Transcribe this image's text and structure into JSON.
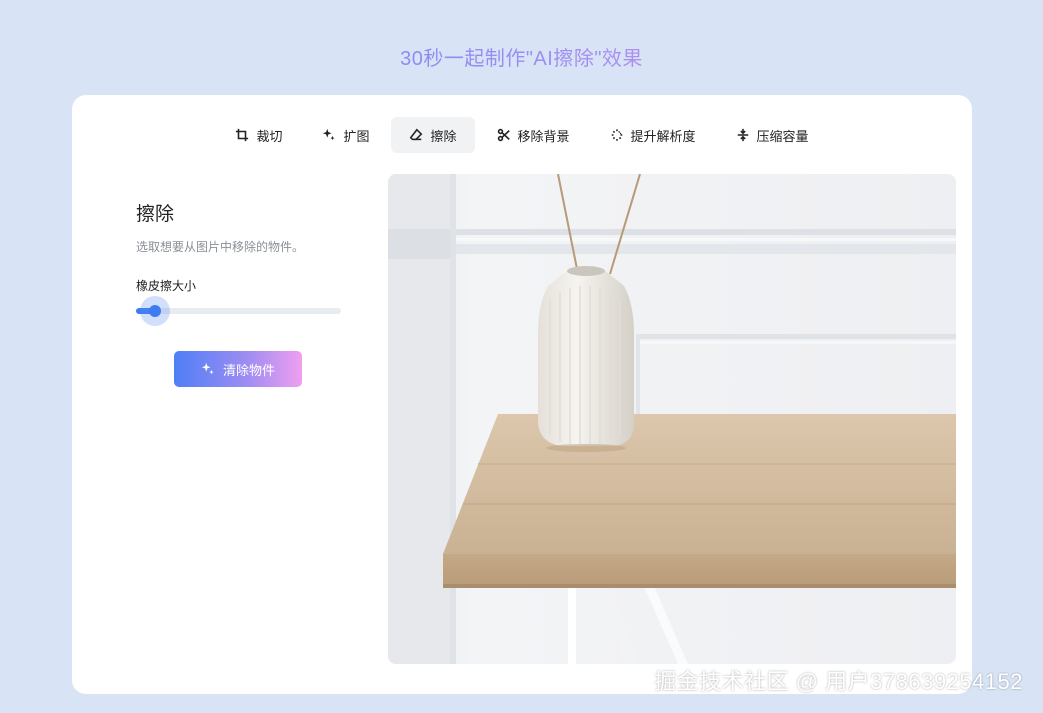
{
  "header": {
    "title": "30秒一起制作\"AI擦除\"效果"
  },
  "tabs": [
    {
      "label": "裁切",
      "icon": "crop-icon"
    },
    {
      "label": "扩图",
      "icon": "sparkle-icon"
    },
    {
      "label": "擦除",
      "icon": "eraser-icon",
      "active": true
    },
    {
      "label": "移除背景",
      "icon": "scissors-icon"
    },
    {
      "label": "提升解析度",
      "icon": "enhance-icon"
    },
    {
      "label": "压缩容量",
      "icon": "compress-icon"
    }
  ],
  "panel": {
    "title": "擦除",
    "description": "选取想要从图片中移除的物件。",
    "slider_label": "橡皮擦大小",
    "slider_value_fraction": 0.1,
    "button_label": "清除物件",
    "button_icon": "sparkle-icon"
  },
  "preview": {
    "image_icon": "preview-image"
  },
  "watermark": {
    "text": "掘金技术社区 @ 用户378639254152"
  },
  "colors": {
    "page_bg": "#d8e4f5",
    "accent": "#3d7bf0",
    "gradient_start": "#4f7ff5",
    "gradient_end": "#ef9ff0"
  }
}
